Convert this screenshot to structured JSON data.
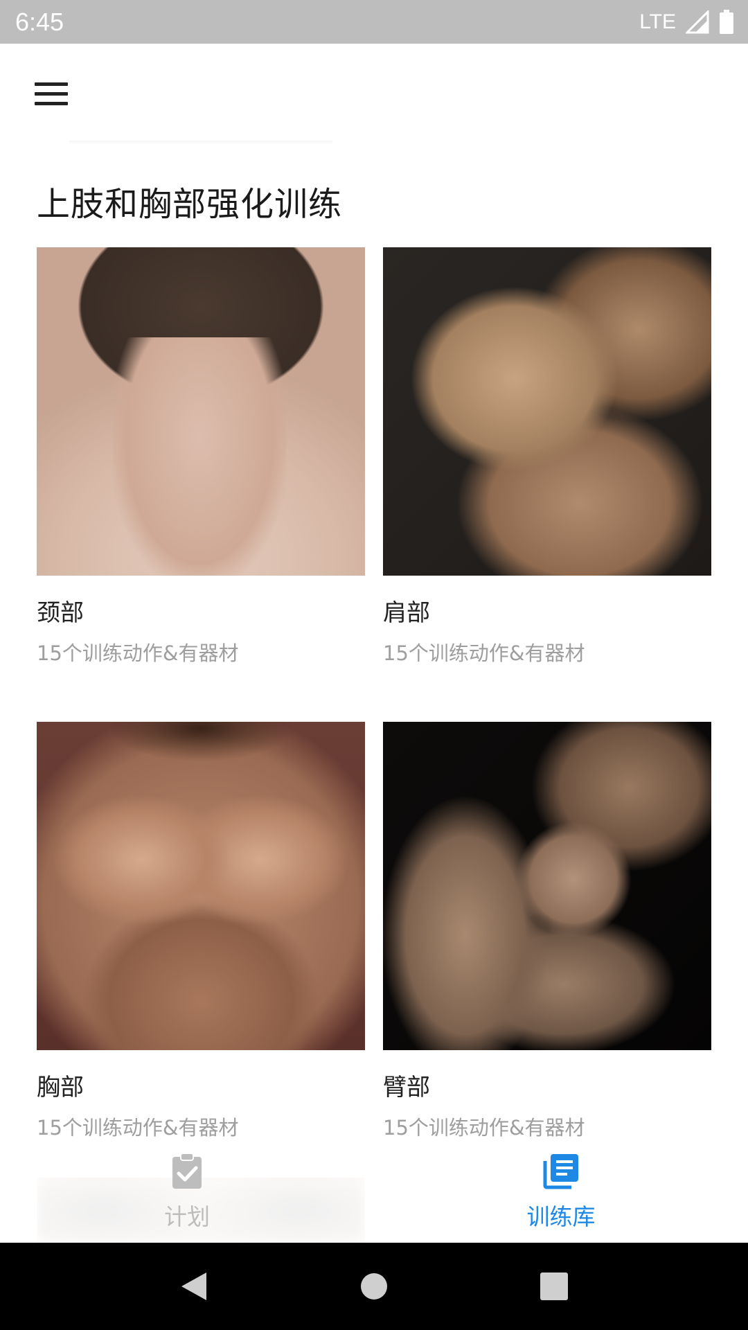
{
  "status_bar": {
    "time": "6:45",
    "network": "LTE"
  },
  "app_bar": {
    "menu_icon": "hamburger-menu-icon"
  },
  "section": {
    "title": "上肢和胸部强化训练"
  },
  "cards": [
    {
      "title": "颈部",
      "subtitle": "15个训练动作&有器材",
      "image": "neck-photo"
    },
    {
      "title": "肩部",
      "subtitle": "15个训练动作&有器材",
      "image": "shoulder-photo"
    },
    {
      "title": "胸部",
      "subtitle": "15个训练动作&有器材",
      "image": "chest-photo"
    },
    {
      "title": "臂部",
      "subtitle": "15个训练动作&有器材",
      "image": "arm-photo"
    }
  ],
  "bottom_nav": {
    "items": [
      {
        "label": "计划",
        "icon": "clipboard-check-icon",
        "active": false
      },
      {
        "label": "训练库",
        "icon": "library-list-icon",
        "active": true
      }
    ],
    "active_color": "#1e88e5",
    "inactive_color": "#bdbdbd"
  },
  "system_nav": {
    "back": "back-triangle-icon",
    "home": "home-circle-icon",
    "recents": "recents-square-icon"
  }
}
